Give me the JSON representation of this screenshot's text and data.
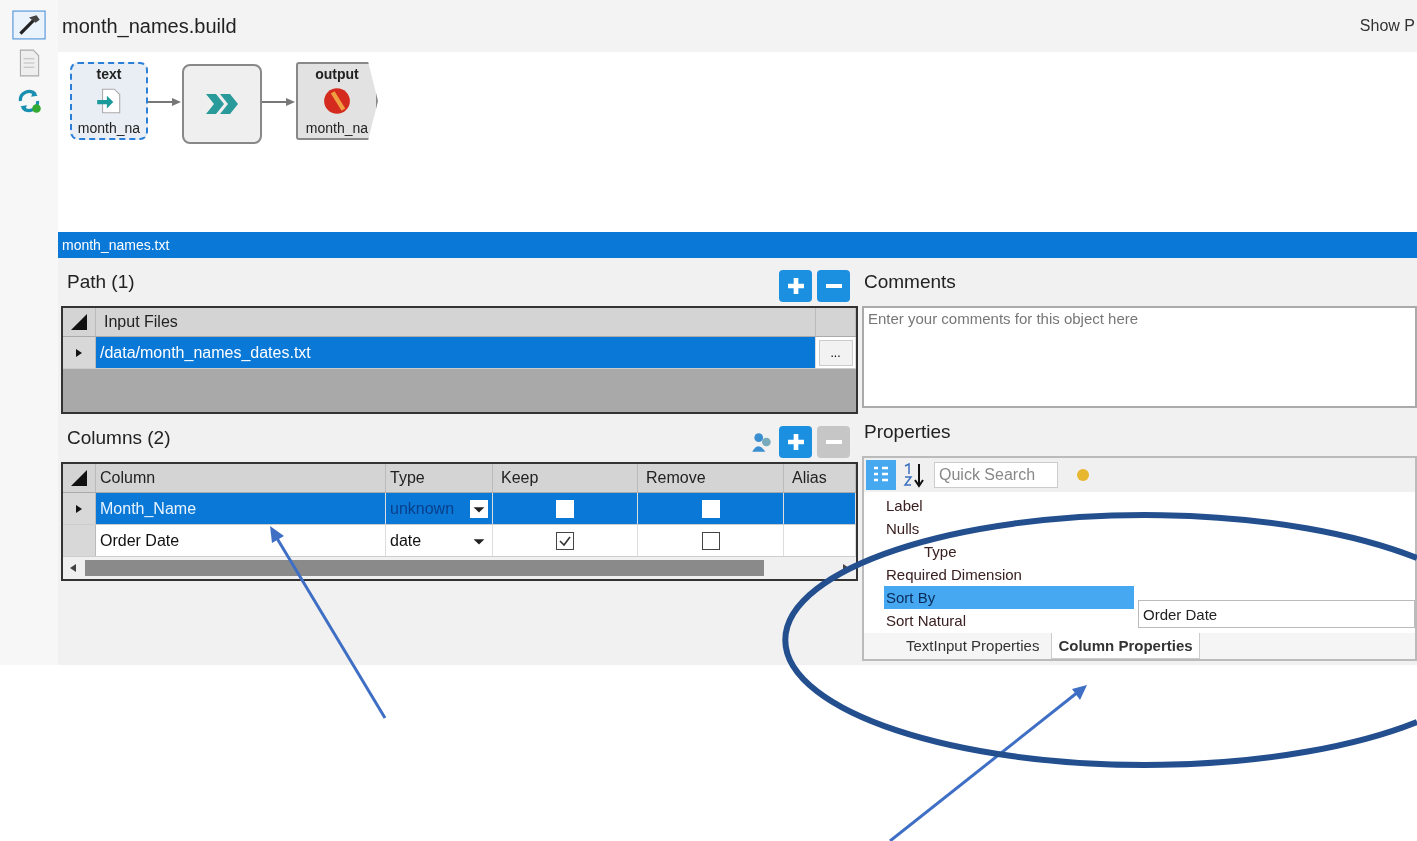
{
  "window": {
    "title": "month_names.build",
    "header_button": "Show P"
  },
  "workflow_nodes": [
    {
      "kind": "input",
      "header": "text",
      "label": "month_na",
      "selected": true
    },
    {
      "kind": "transform",
      "selected": false
    },
    {
      "kind": "output",
      "header": "output",
      "label": "month_na",
      "selected": false
    }
  ],
  "selected_object": "month_names.txt",
  "path_section": {
    "title": "Path (1)",
    "buttons": [
      {
        "kind": "add",
        "disabled": false
      },
      {
        "kind": "remove",
        "disabled": false
      }
    ],
    "column": "Input Files",
    "rows": [
      {
        "value": "/data/month_names_dates.txt",
        "selected": true,
        "button": "..."
      }
    ]
  },
  "columns_section": {
    "title": "Columns (2)",
    "buttons": [
      {
        "kind": "add",
        "disabled": false
      },
      {
        "kind": "remove",
        "disabled": true
      }
    ],
    "headers": [
      "Column",
      "Type",
      "Keep",
      "Remove",
      "Alias"
    ],
    "rows": [
      {
        "name": "Month_Name",
        "type": "unknown",
        "keep": false,
        "remove": false,
        "selected": true
      },
      {
        "name": "Order Date",
        "type": "date",
        "keep": true,
        "remove": false,
        "selected": false
      }
    ]
  },
  "comments": {
    "title": "Comments",
    "placeholder": "Enter your comments for this object here"
  },
  "properties": {
    "title": "Properties",
    "search_placeholder": "Quick Search",
    "items": [
      {
        "label": "Label",
        "selected": false
      },
      {
        "label": "Nulls",
        "selected": false
      },
      {
        "label": "Type",
        "selected": false
      },
      {
        "label": "Required Dimension",
        "selected": false
      },
      {
        "label": "Sort By",
        "selected": true
      },
      {
        "label": "Sort Natural",
        "selected": false
      }
    ],
    "dropdown_option": "Order Date",
    "tabs": [
      {
        "label": "TextInput Properties",
        "selected": false
      },
      {
        "label": "Column Properties",
        "selected": true
      }
    ]
  }
}
